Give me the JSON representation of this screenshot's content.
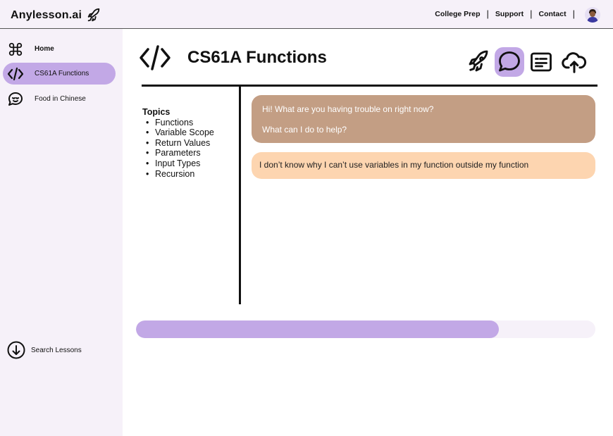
{
  "header": {
    "brand": "Anylesson.ai",
    "nav": [
      "College Prep",
      "Support",
      "Contact"
    ]
  },
  "sidebar": {
    "items": [
      {
        "label": "Home",
        "icon": "command-icon"
      },
      {
        "label": "CS61A Functions",
        "icon": "code-icon",
        "active": true
      },
      {
        "label": "Food in Chinese",
        "icon": "chat-face-icon"
      }
    ],
    "search_label": "Search Lessons"
  },
  "lesson": {
    "title": "CS61A Functions",
    "tools": [
      "rocket-icon",
      "chat-bubble-icon",
      "notes-icon",
      "cloud-upload-icon"
    ],
    "active_tool": "chat-bubble-icon"
  },
  "topics": {
    "heading": "Topics",
    "items": [
      "Functions",
      "Variable Scope",
      "Return Values",
      "Parameters",
      "Input Types",
      "Recursion"
    ]
  },
  "chat": {
    "ai_message": [
      "Hi! What are you having trouble on right now?",
      "What can I do to help?"
    ],
    "user_message": "I don’t know why I can’t use variables in my function outside my function"
  },
  "progress": {
    "fraction": 0.79
  },
  "colors": {
    "accent": "#c2a8e6",
    "panel": "#f6f1f9",
    "ai_bubble": "#c39e84",
    "user_bubble": "#fdd5b0"
  }
}
